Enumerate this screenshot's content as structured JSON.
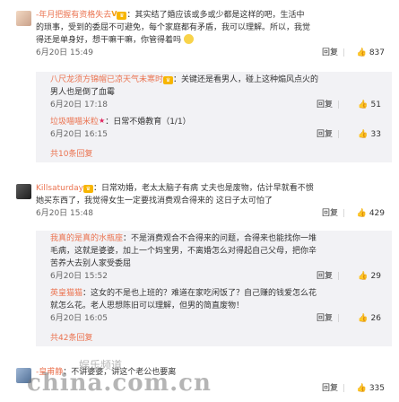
{
  "comments": [
    {
      "username": "-年月把握有资格失去",
      "content_lines": [
        "：其实结了婚应该或多或少都是这样的吧，生活中",
        "的琐事，受到的委屈不可避免，每个家庭都有矛盾，我可以理解。所以，我觉",
        "得还是单身好，想干嘛干嘛，你管得着吗"
      ],
      "time": "6月20日 15:49",
      "reply_label": "回复",
      "likes": "837",
      "replies": [
        {
          "username": "八尺龙须方锦帽已凉天气未寒时",
          "content_lines": [
            "：关键还是看男人，碰上这种煽风点火的",
            "男人也是倒了血霉"
          ],
          "time": "6月20日 17:18",
          "reply_label": "回复",
          "likes": "51"
        },
        {
          "username": "垃圾喵喵米粒",
          "content_lines": [
            "：日常不婚教育（1/1）"
          ],
          "time": "6月20日 16:15",
          "reply_label": "回复",
          "likes": "33"
        }
      ],
      "more": "共10条回复"
    },
    {
      "username": "Killsaturday",
      "content_lines": [
        "：日常劝婚，老太太脑子有病 丈夫也是废物，估计早就看不惯",
        "她买东西了，我觉得女生一定要找消费观合得来的 这日子太可怕了"
      ],
      "time": "6月20日 15:48",
      "reply_label": "回复",
      "likes": "429",
      "replies": [
        {
          "username": "我真的是真的水瓶座",
          "content_lines": [
            "：不是消费观合不合得来的问题，合得来也能找你一堆",
            "毛病，这就是婆婆，加上一个妈宝男，不离婚怎么对得起自己父母，把你辛",
            "苦养大去别人家受委屈"
          ],
          "time": "6月20日 15:52",
          "reply_label": "回复",
          "likes": "29"
        },
        {
          "username": "英皇猫猫",
          "content_lines": [
            "：这女的不是也上班的？难道在家吃闲饭了？自己赚的钱爱怎么花",
            "就怎么花。老人思想陈旧可以理解，但男的简直废物！"
          ],
          "time": "6月20日 16:05",
          "reply_label": "回复",
          "likes": "26"
        }
      ],
      "more": "共42条回复"
    },
    {
      "username": "-皇甫静",
      "content_lines": [
        "：不讲婆婆，讲这个老公也要离"
      ],
      "reply_label": "回复",
      "likes": "335"
    }
  ],
  "watermark": {
    "site": "china.com.cn",
    "label": "娱乐频道"
  }
}
